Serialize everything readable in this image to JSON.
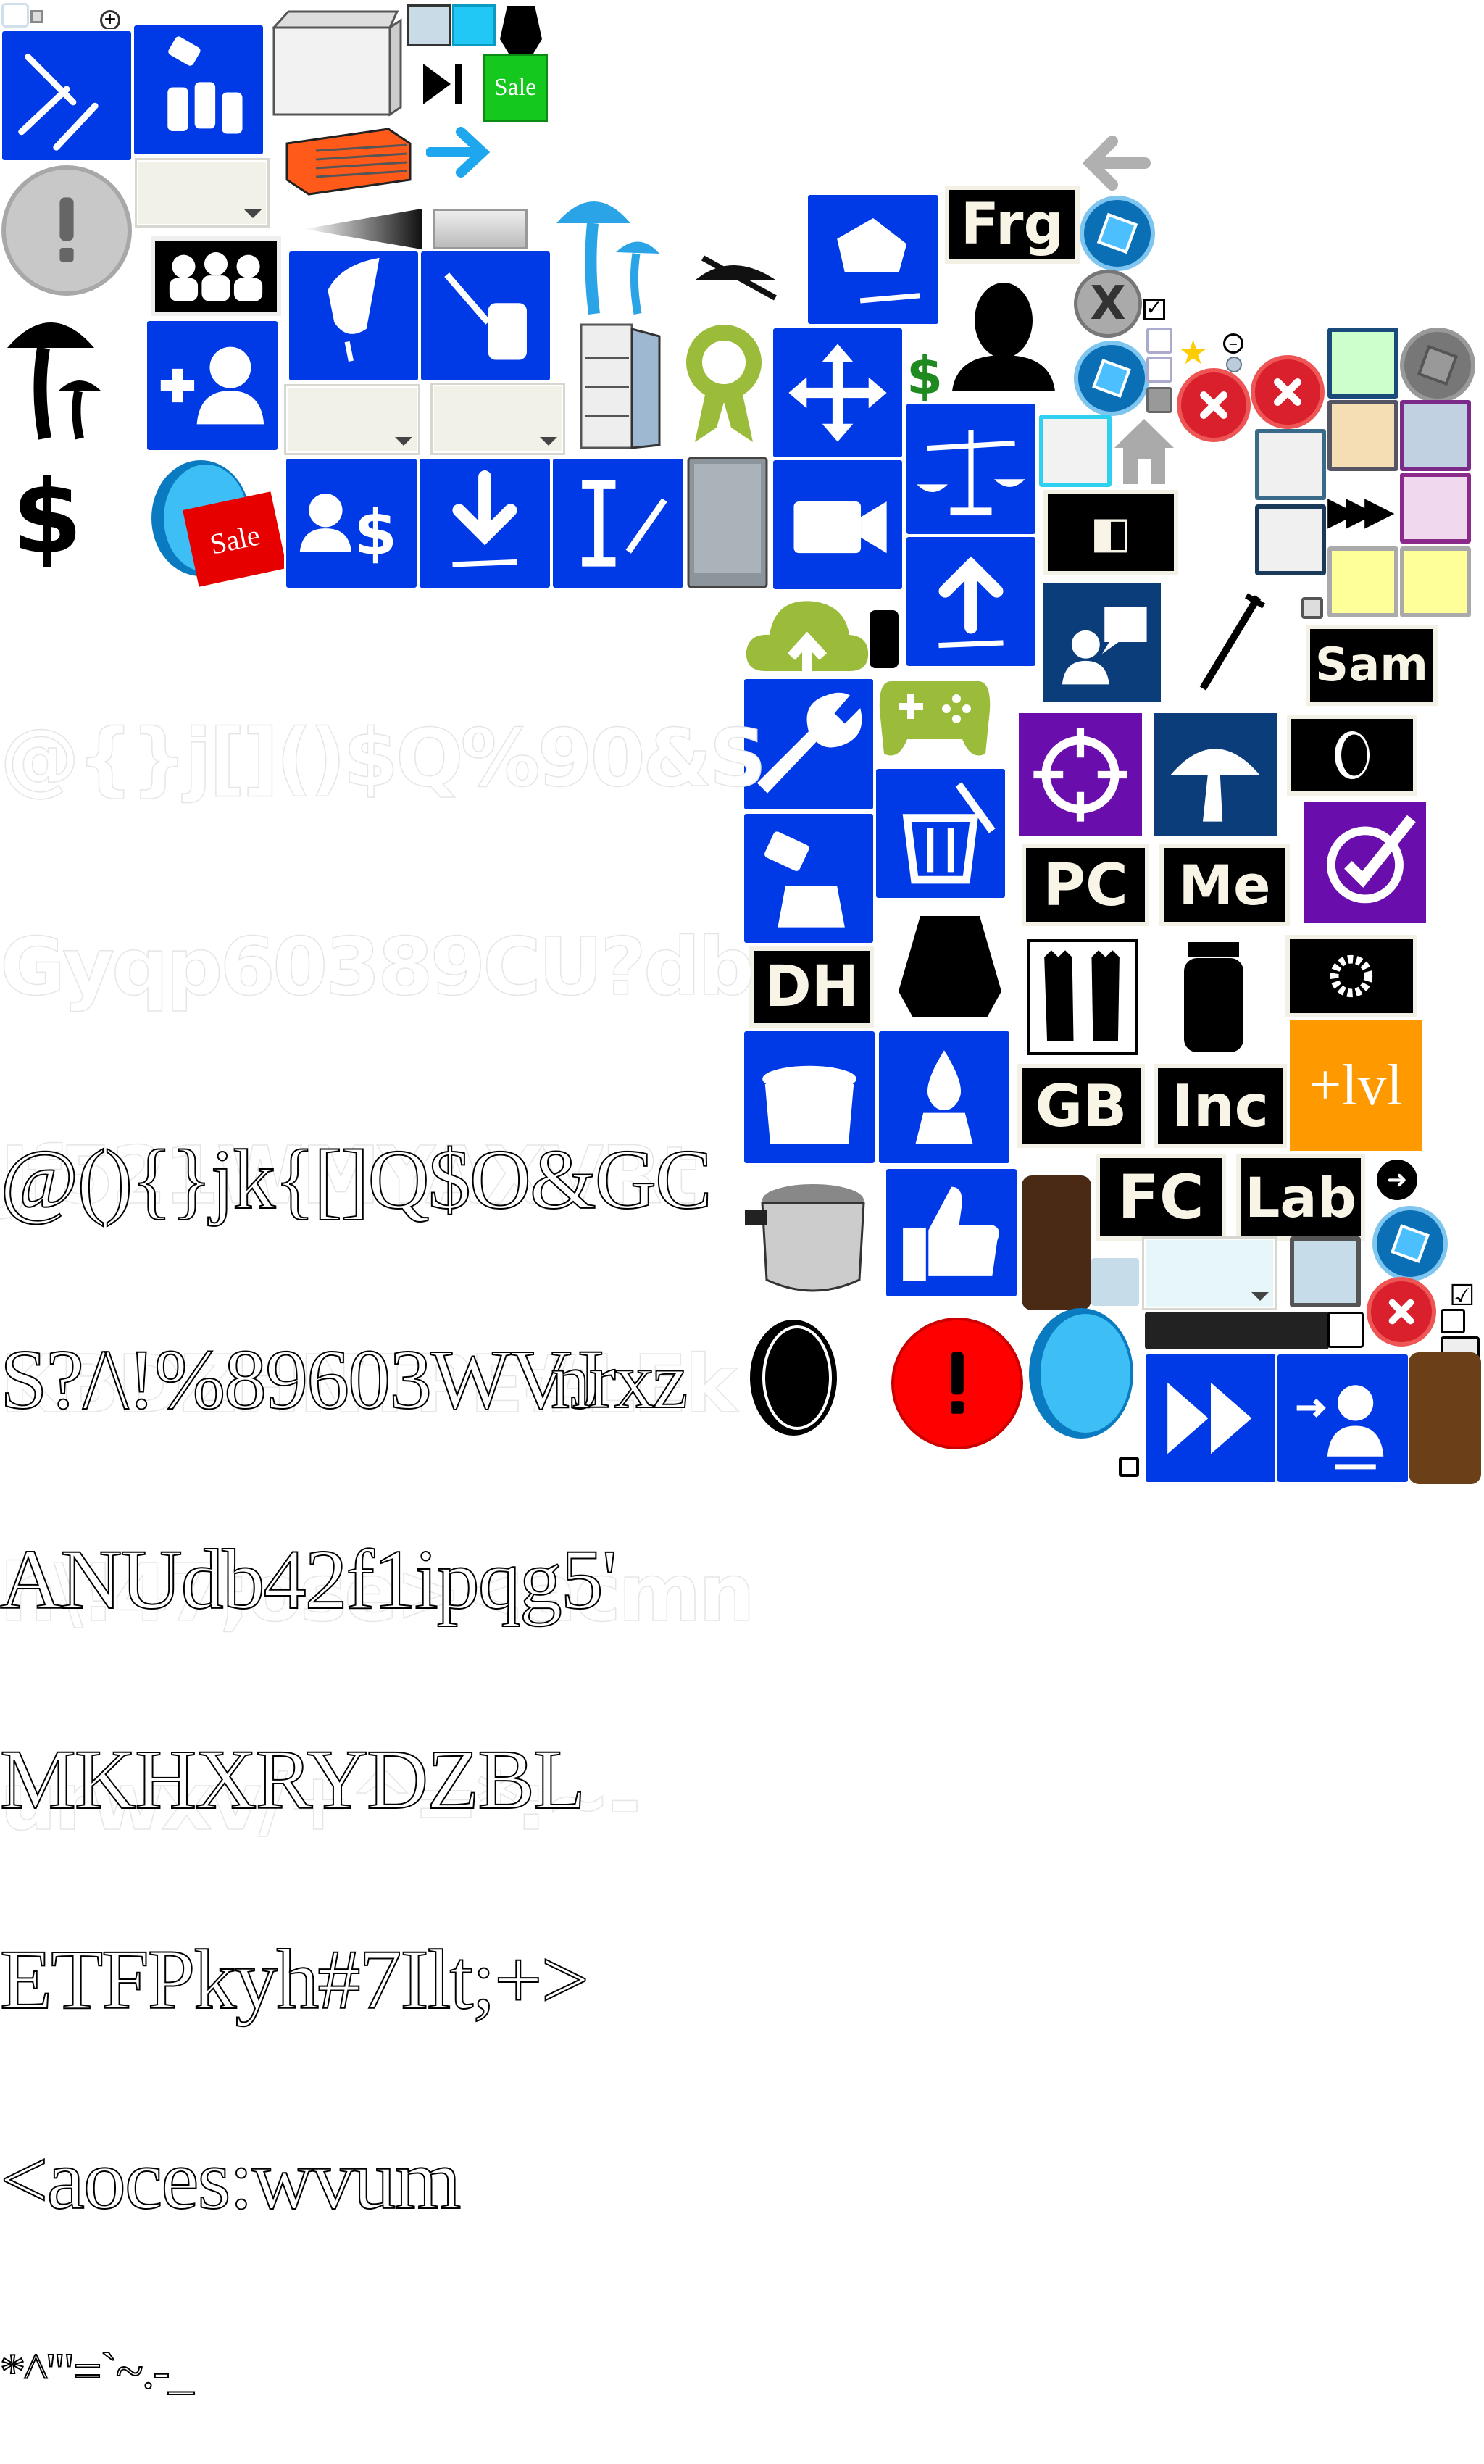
{
  "atlas": {
    "labels": {
      "sale_green": "Sale",
      "sale_red": "Sale",
      "frg": "Frg",
      "sam": "Sam",
      "pc": "PC",
      "me": "Me",
      "dh": "DH",
      "gb": "GB",
      "inc": "Inc",
      "fc": "FC",
      "lab": "Lab",
      "lvl": "+lvl",
      "dollar": "$",
      "dollar_green": "$"
    },
    "glyph_rows_outline": [
      "@(){}jk{[]Q$O&GC",
      "S?/\\!%89603WVJ",
      "ANUdb42f1ipqg5'",
      "MKHXRYDZBL",
      "ETFPkyh#7Ilt;+>",
      "<aoces:wvum",
      "*^'\"=`~.-_"
    ],
    "glyph_rows_faint": [
      "@{}j[]()$Q%90&S",
      "Gyqp60389CU?db",
      "Jf521WMYAXVRt",
      "KBDZHNTPE#LEk",
      "h\\!47;ose><acmn",
      "urwxv/+^=*:~-"
    ],
    "glyph_extra": "nrxz",
    "colors": {
      "tile_blue": "#0039e6",
      "tile_navy": "#0b3d7a",
      "tile_purple": "#6a0dad",
      "olive_green": "#9bbb3a",
      "sale_green": "#14c81e",
      "sale_red": "#e60000",
      "orange_lvl": "#ff9900",
      "red_close": "#d9202c"
    },
    "icons": [
      "syringes-icon",
      "jars-icon",
      "chest-freezer-icon",
      "dehydrator-icon",
      "arrow-right-icon",
      "alert-icon",
      "mushroom-icon",
      "dollar-icon",
      "group-icon",
      "add-user-icon",
      "coin-icon",
      "hand-pick-icon",
      "syringe-jar-icon",
      "user-dollar-icon",
      "download-syringe-icon",
      "text-syringe-icon",
      "mushroom-blue-icon",
      "fridge-icon",
      "award-icon",
      "mini-fridge-icon",
      "move-icon",
      "move-camera-icon",
      "scale-icon",
      "upload-syringe-icon",
      "cloud-upload-icon",
      "gamepad-icon",
      "wrench-icon",
      "trash-icon",
      "pour-icon",
      "cap-icon",
      "pot-icon",
      "drop-icon",
      "pressure-cooker-icon",
      "thumbs-up-icon",
      "jar-icon",
      "gloves-icon",
      "gear-icon",
      "user-chat-icon",
      "target-icon",
      "mushroom-white-icon",
      "coin-black-icon",
      "target-check-icon",
      "home-icon",
      "close-icon",
      "settings-icon",
      "fast-forward-icon",
      "user-transfer-icon",
      "grain-jar-icon",
      "back-arrow-icon",
      "star-icon"
    ]
  }
}
